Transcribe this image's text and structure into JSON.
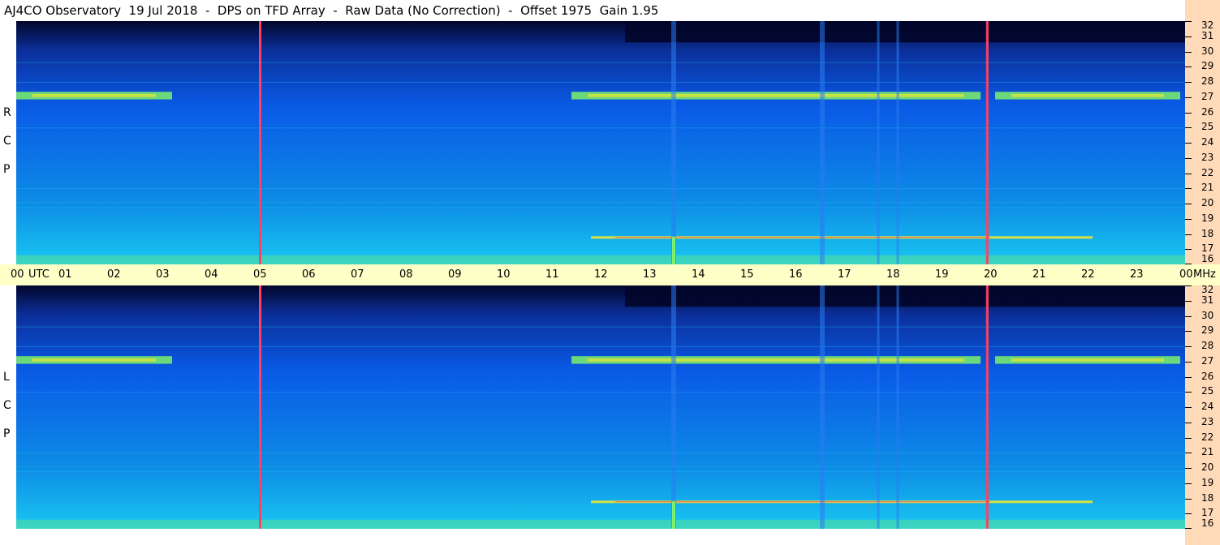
{
  "header": {
    "title": "AJ4CO Observatory  19 Jul 2018  -  DPS on TFD Array  -  Raw Data (No Correction)  -  Offset 1975  Gain 1.95"
  },
  "chart_data": [
    {
      "type": "heatmap",
      "panel": "RCP",
      "ylabel": "R C P",
      "x": [
        "00",
        "01",
        "02",
        "03",
        "04",
        "05",
        "06",
        "07",
        "08",
        "09",
        "10",
        "11",
        "12",
        "13",
        "14",
        "15",
        "16",
        "17",
        "18",
        "19",
        "20",
        "21",
        "22",
        "23",
        "00"
      ],
      "xlabel": "UTC",
      "y_ticks": [
        "16",
        "17",
        "18",
        "19",
        "20",
        "21",
        "22",
        "23",
        "24",
        "25",
        "26",
        "27",
        "28",
        "29",
        "30",
        "31",
        "32"
      ],
      "y_unit": "MHz",
      "ylim": [
        16,
        32
      ],
      "xlim": [
        0,
        24
      ]
    },
    {
      "type": "heatmap",
      "panel": "LCP",
      "ylabel": "L C P",
      "x": [
        "00",
        "01",
        "02",
        "03",
        "04",
        "05",
        "06",
        "07",
        "08",
        "09",
        "10",
        "11",
        "12",
        "13",
        "14",
        "15",
        "16",
        "17",
        "18",
        "19",
        "20",
        "21",
        "22",
        "23",
        "00"
      ],
      "xlabel": "UTC",
      "y_ticks": [
        "16",
        "17",
        "18",
        "19",
        "20",
        "21",
        "22",
        "23",
        "24",
        "25",
        "26",
        "27",
        "28",
        "29",
        "30",
        "31",
        "32"
      ],
      "y_unit": "MHz",
      "ylim": [
        16,
        32
      ],
      "xlim": [
        0,
        24
      ]
    }
  ],
  "colors": {
    "background_deep": "#02062a",
    "base_blue": "#0a5ae6",
    "cyan": "#19c8f0",
    "green": "#7cf06a",
    "yellow": "#f0e632",
    "marker_red": "#ff4060",
    "time_bar": "#ffffc8",
    "right_strip": "#ffdab9"
  },
  "labels": {
    "utc": "UTC",
    "mhz": "MHz"
  },
  "markers": [
    5.0,
    19.93
  ]
}
